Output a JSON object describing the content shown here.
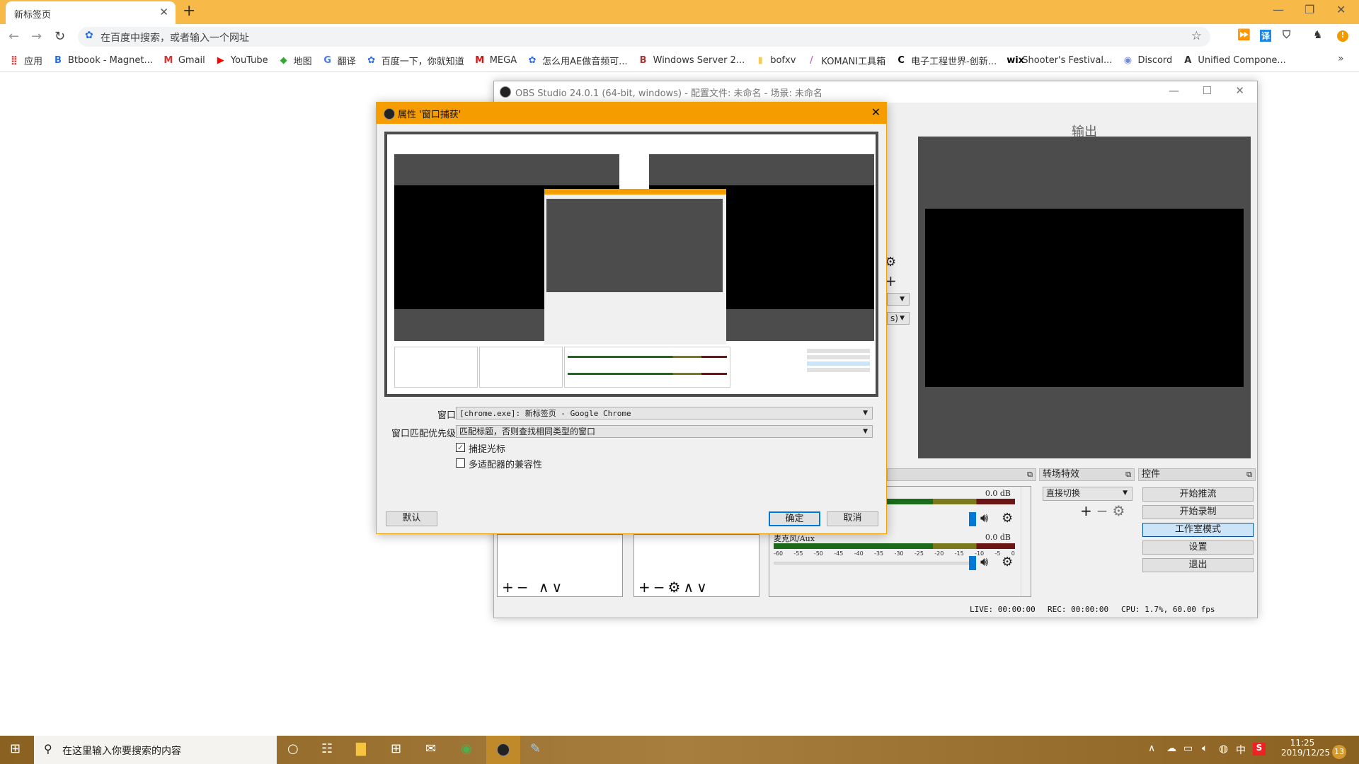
{
  "browser": {
    "tab_title": "新标签页",
    "new_tab": "+",
    "address_placeholder": "在百度中搜索，或者输入一个网址",
    "bookmarks": [
      {
        "icon": "apps-grid-icon",
        "g": "⣿",
        "c": "#e44",
        "label": "应用"
      },
      {
        "icon": "btbook-icon",
        "g": "B",
        "c": "#2b6de5",
        "label": "Btbook - Magnet..."
      },
      {
        "icon": "gmail-icon",
        "g": "M",
        "c": "#d33",
        "label": "Gmail"
      },
      {
        "icon": "youtube-icon",
        "g": "▶",
        "c": "#f00",
        "label": "YouTube"
      },
      {
        "icon": "maps-icon",
        "g": "◆",
        "c": "#3a3",
        "label": "地图"
      },
      {
        "icon": "translate-icon",
        "g": "G",
        "c": "#4a7be8",
        "label": "翻译"
      },
      {
        "icon": "baidu-icon",
        "g": "✿",
        "c": "#2b6de5",
        "label": "百度一下，你就知道"
      },
      {
        "icon": "mega-icon",
        "g": "M",
        "c": "#d11",
        "label": "MEGA"
      },
      {
        "icon": "baidu-icon",
        "g": "✿",
        "c": "#2b6de5",
        "label": "怎么用AE做音频可..."
      },
      {
        "icon": "windows-server-icon",
        "g": "B",
        "c": "#a33",
        "label": "Windows Server 2..."
      },
      {
        "icon": "folder-icon",
        "g": "▮",
        "c": "#f5cc55",
        "label": "bofxv"
      },
      {
        "icon": "komani-icon",
        "g": "/",
        "c": "#c6c",
        "label": "KOMANI工具箱"
      },
      {
        "icon": "eeworld-icon",
        "g": "C",
        "c": "#000",
        "label": "电子工程世界-创新..."
      },
      {
        "icon": "wix-icon",
        "g": "wix",
        "c": "#000",
        "label": "Shooter's Festival..."
      },
      {
        "icon": "discord-icon",
        "g": "◉",
        "c": "#7289da",
        "label": "Discord"
      },
      {
        "icon": "unity-icon",
        "g": "A",
        "c": "#333",
        "label": "Unified Compone..."
      }
    ],
    "more": "»"
  },
  "obs": {
    "title": "OBS Studio 24.0.1 (64-bit, windows) - 配置文件: 未命名 - 场景: 未命名",
    "output_label": "输出",
    "transitions": {
      "header": "转场特效",
      "selected": "直接切换"
    },
    "controls": {
      "header": "控件",
      "buttons": [
        "开始推流",
        "开始录制",
        "工作室模式",
        "设置",
        "退出"
      ]
    },
    "mixer": {
      "channels": [
        {
          "name": "",
          "db": "0.0 dB"
        },
        {
          "name": "麦克风/Aux",
          "db": "0.0 dB"
        }
      ],
      "ticks": [
        "-60",
        "-55",
        "-50",
        "-45",
        "-40",
        "-35",
        "-30",
        "-25",
        "-20",
        "-15",
        "-10",
        "-5",
        "0"
      ]
    },
    "partial_dropdown_text": "s)",
    "status": {
      "live": "LIVE: 00:00:00",
      "rec": "REC: 00:00:00",
      "cpu": "CPU: 1.7%, 60.00 fps"
    }
  },
  "dialog": {
    "title": "属性 '窗口捕获'",
    "window_label": "窗口",
    "window_value": "[chrome.exe]: 新标签页 - Google Chrome",
    "priority_label": "窗口匹配优先级",
    "priority_value": "匹配标题，否则查找相同类型的窗口",
    "capture_cursor": {
      "label": "捕捉光标",
      "checked": true
    },
    "multi_adapter": {
      "label": "多适配器的兼容性",
      "checked": false
    },
    "defaults": "默认",
    "ok": "确定",
    "cancel": "取消"
  },
  "taskbar": {
    "search_placeholder": "在这里输入你要搜索的内容",
    "time": "11:25",
    "date": "2019/12/25",
    "ime": "中",
    "notifications": "13"
  }
}
